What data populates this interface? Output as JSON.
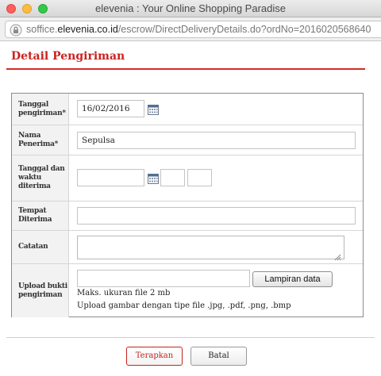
{
  "window": {
    "title": "elevenia : Your Online Shopping Paradise",
    "url_prefix": "soffice.",
    "url_domain": "elevenia.co.id",
    "url_path": "/escrow/DirectDeliveryDetails.do?ordNo=2016020568640"
  },
  "page": {
    "title": "Detail Pengiriman"
  },
  "form": {
    "tanggal_pengiriman": {
      "label": "Tanggal pengiriman*",
      "value": "16/02/2016"
    },
    "nama_penerima": {
      "label": "Nama Penerima*",
      "value": "Sepulsa"
    },
    "tanggal_waktu_diterima": {
      "label": "Tanggal dan waktu diterima",
      "date": "",
      "hour": "",
      "minute": ""
    },
    "tempat_diterima": {
      "label": "Tempat Diterima",
      "value": ""
    },
    "catatan": {
      "label": "Catatan",
      "value": ""
    },
    "upload": {
      "label": "Upload bukti pengiriman",
      "file_value": "",
      "button": "Lampiran data",
      "note_size": "Maks. ukuran file 2 mb",
      "note_types": "Upload gambar dengan tipe file .jpg, .pdf, .png, .bmp"
    }
  },
  "actions": {
    "apply": "Terapkan",
    "cancel": "Batal"
  },
  "colors": {
    "accent": "#c9231e",
    "label_bg": "#f2f2f2"
  }
}
